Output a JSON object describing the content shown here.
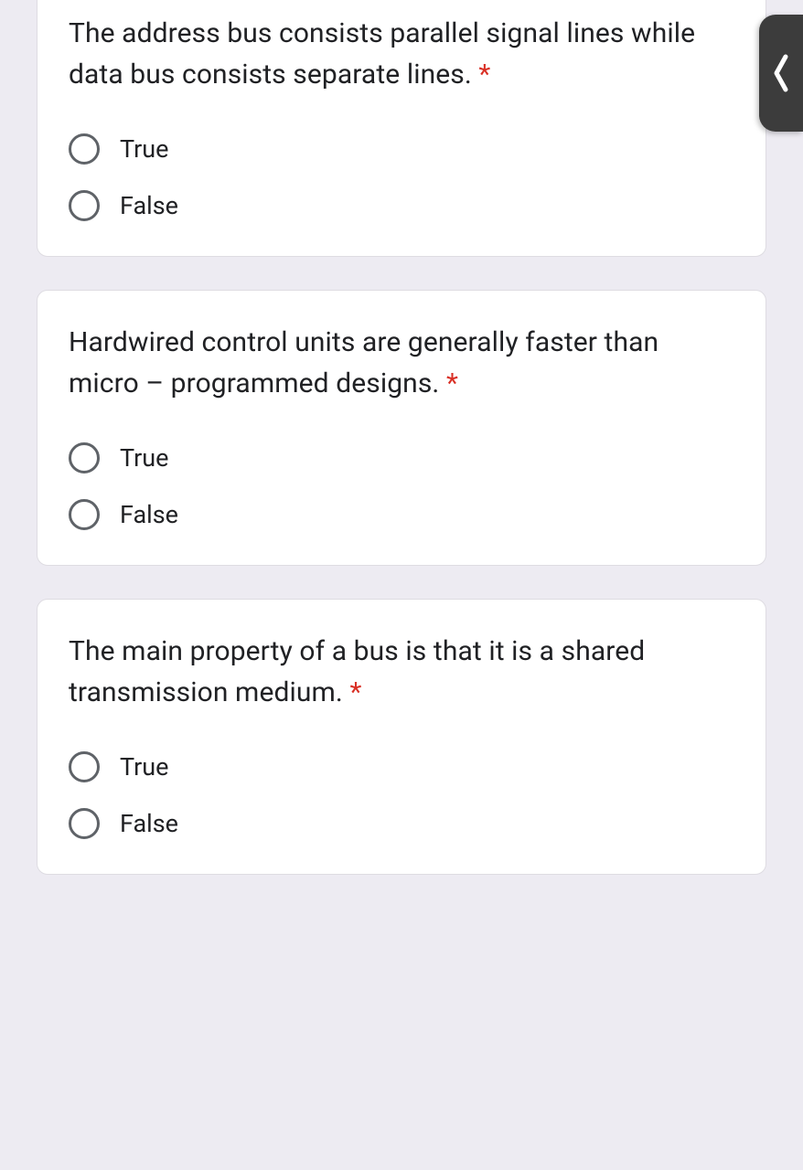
{
  "questions": [
    {
      "text": "The address bus consists parallel signal lines while data bus consists separate lines. ",
      "required": "*",
      "options": [
        "True",
        "False"
      ]
    },
    {
      "text": "Hardwired control units are generally faster than micro – programmed designs. ",
      "required": "*",
      "options": [
        "True",
        "False"
      ]
    },
    {
      "text": "The main property of a bus is that it is a shared transmission medium. ",
      "required": "*",
      "options": [
        "True",
        "False"
      ]
    }
  ]
}
